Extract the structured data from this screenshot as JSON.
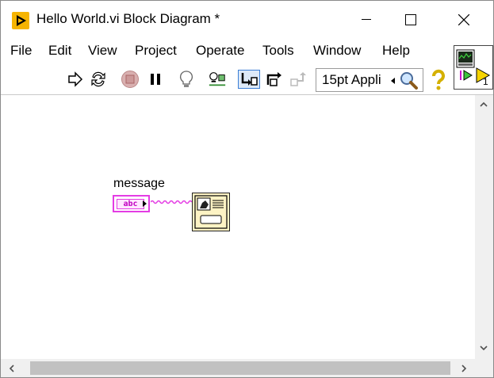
{
  "window": {
    "title": "Hello World.vi Block Diagram *",
    "controls": [
      "minimize",
      "maximize",
      "close"
    ]
  },
  "menu": {
    "items": [
      "File",
      "Edit",
      "View",
      "Project",
      "Operate",
      "Tools",
      "Window",
      "Help"
    ]
  },
  "toolbar": {
    "icons": [
      "run-arrow-icon",
      "run-continuously-icon",
      "abort-icon",
      "pause-icon",
      "highlight-execution-icon",
      "retain-wire-values-icon",
      "step-into-icon",
      "step-over-icon",
      "step-out-icon"
    ],
    "font_select": "15pt Appli",
    "active_icon": "step-into-icon"
  },
  "connector_pane": {
    "terminal_number": "1"
  },
  "diagram": {
    "constant_label": "message",
    "constant_text": "abc",
    "node": "one-button-dialog-icon"
  },
  "colors": {
    "string_wire": "#e43ce4",
    "node_fill": "#fdf3c4",
    "scrollbar_thumb": "#c1c1c1"
  }
}
